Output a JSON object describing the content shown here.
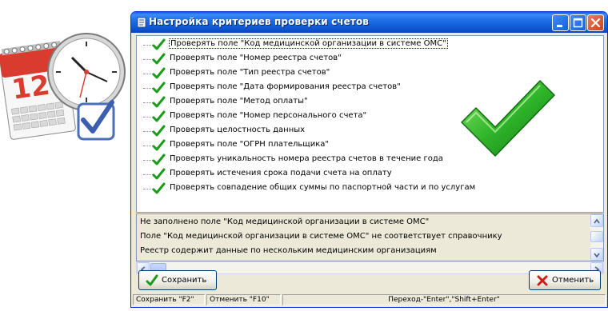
{
  "window": {
    "title": "Настройка критериев проверки счетов"
  },
  "criteria": {
    "items": [
      {
        "label": "Проверять поле \"Код медицинской организации в системе ОМС\"",
        "checked": true,
        "selected": true
      },
      {
        "label": "Проверять поле \"Номер реестра счетов\"",
        "checked": true
      },
      {
        "label": "Проверять поле \"Тип реестра счетов\"",
        "checked": true
      },
      {
        "label": "Проверять поле \"Дата формирования реестра счетов\"",
        "checked": true
      },
      {
        "label": "Проверять поле \"Метод оплаты\"",
        "checked": true
      },
      {
        "label": "Проверять поле \"Номер персонального счета\"",
        "checked": true
      },
      {
        "label": "Проверять целостность данных",
        "checked": true
      },
      {
        "label": "Проверять поле \"ОГРН плательщика\"",
        "checked": true
      },
      {
        "label": "Проверять уникальность номера реестра счетов в течение года",
        "checked": true
      },
      {
        "label": "Проверять истечения срока подачи счета на оплату",
        "checked": true
      },
      {
        "label": "Проверять совпадение общих суммы по паспортной части и по услугам",
        "checked": true
      }
    ]
  },
  "messages": {
    "lines": [
      "Не заполнено поле \"Код медицинской организации в системе ОМС\"",
      "Поле \"Код медицинской организации в системе ОМС\" не соответствует справочнику",
      "Реестр содержит данные по нескольким медицинским организациям"
    ]
  },
  "buttons": {
    "save": "Сохранить",
    "cancel": "Отменить"
  },
  "statusbar": {
    "save_hint": "Сохранить \"F2\"",
    "cancel_hint": "Отменить \"F10\"",
    "nav_hint": "Переход-\"Enter\",\"Shift+Enter\""
  },
  "colors": {
    "titlebar": "#0a5fde",
    "check_green": "#1a9c1a",
    "close_button": "#c9441c",
    "cancel_x": "#c8201a"
  },
  "icons": {
    "app": "calendar-clock-check-icon",
    "title": "document-icon",
    "item_check": "green-check-icon",
    "big_check": "big-green-check-icon",
    "save": "green-check-icon",
    "cancel": "red-x-icon"
  }
}
